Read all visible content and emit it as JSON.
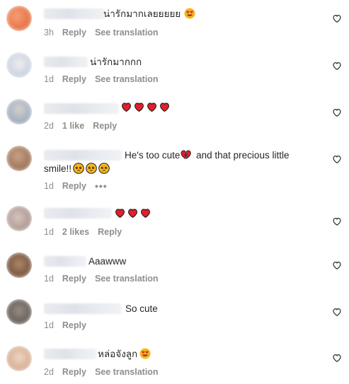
{
  "comments": [
    {
      "text": "น่ารักมากเลยยยยย",
      "time": "3h",
      "reply": "Reply",
      "see_translation": "See translation"
    },
    {
      "text": "น่ารักมากกก",
      "time": "1d",
      "reply": "Reply",
      "see_translation": "See translation"
    },
    {
      "text": "",
      "time": "2d",
      "likes": "1 like",
      "reply": "Reply"
    },
    {
      "text_part1": "He's too cute",
      "text_part2": " and that precious little",
      "text_line2": "smile!!",
      "time": "1d",
      "reply": "Reply",
      "more": "•••"
    },
    {
      "text": "",
      "time": "1d",
      "likes": "2 likes",
      "reply": "Reply"
    },
    {
      "text": "Aaawww",
      "time": "1d",
      "reply": "Reply",
      "see_translation": "See translation"
    },
    {
      "text": "So cute",
      "time": "1d",
      "reply": "Reply"
    },
    {
      "text": "หล่อจังลูก",
      "time": "2d",
      "reply": "Reply",
      "see_translation": "See translation"
    }
  ],
  "icons": {
    "like": "heart-outline-icon",
    "heart_emoji": "red-heart-emoji",
    "heart_eyes": "heart-eyes-emoji",
    "broken_heart": "broken-heart-emoji",
    "pleading": "pleading-face-emoji"
  },
  "colors": {
    "text": "#262626",
    "secondary": "#8e8e8e",
    "heart": "#e0202e"
  }
}
